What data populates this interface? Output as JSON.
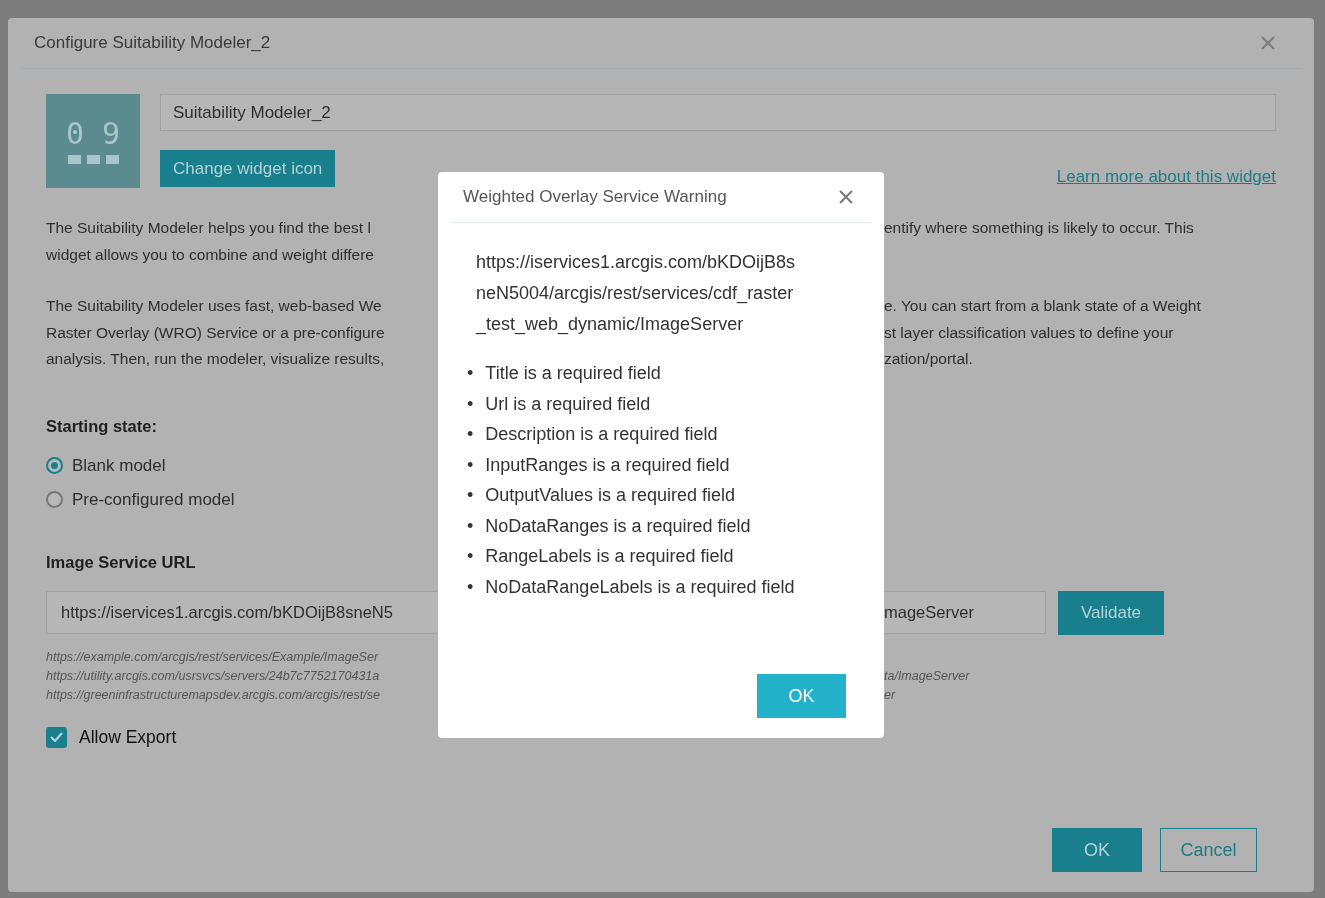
{
  "config_dialog": {
    "title": "Configure Suitability Modeler_2",
    "widget_icon_label": "0 9",
    "name_field": {
      "value": "Suitability Modeler_2"
    },
    "change_icon_button": "Change widget icon",
    "learn_more_link": "Learn more about this widget",
    "description": [
      [
        {
          "left": "The Suitability Modeler helps you find the best l",
          "right": "entify where something is likely to occur. This"
        },
        {
          "left": "widget allows you to combine and weight differe"
        }
      ],
      [
        {
          "left": "The Suitability Modeler uses fast, web-based We",
          "right": "e. You can start from a blank state of a Weight"
        },
        {
          "left": "Raster Overlay (WRO) Service or a pre-configure",
          "right": "st layer classification values to define your"
        },
        {
          "left": "analysis. Then, run the modeler, visualize results,",
          "right": "zation/portal."
        }
      ]
    ],
    "starting_state": {
      "label": "Starting state:",
      "options": [
        {
          "label": "Blank model",
          "selected": true
        },
        {
          "label": "Pre-configured model",
          "selected": false
        }
      ]
    },
    "image_service_url": {
      "label": "Image Service URL",
      "value_left": "https://iservices1.arcgis.com/bKDOijB8sneN5",
      "value_right": "mageServer"
    },
    "validate_button": "Validate",
    "examples": [
      {
        "left": "https://example.com/arcgis/rest/services/Example/ImageSer"
      },
      {
        "left": "https://utility.arcgis.com/usrsvcs/servers/24b7c7752170431a",
        "right": "ta/ImageServer"
      },
      {
        "left": "https://greeninfrastructuremapsdev.arcgis.com/arcgis/rest/se",
        "right": "er"
      }
    ],
    "allow_export": {
      "label": "Allow Export",
      "checked": true
    },
    "buttons": [
      {
        "label": "OK",
        "kind": "primary"
      },
      {
        "label": "Cancel",
        "kind": "secondary"
      }
    ]
  },
  "warning_dialog": {
    "title": "Weighted Overlay Service Warning",
    "message": "https://iservices1.arcgis.com/bKDOijB8sneN5004/arcgis/rest/services/cdf_raster_test_web_dynamic/ImageServer",
    "items": [
      {
        "bullet": "•",
        "text": "Title is a required field"
      },
      {
        "bullet": "•",
        "text": "Url is a required field"
      },
      {
        "bullet": "•",
        "text": "Description is a required field"
      },
      {
        "bullet": "•",
        "text": "InputRanges is a required field"
      },
      {
        "bullet": "•",
        "text": "OutputValues is a required field"
      },
      {
        "bullet": "•",
        "text": "NoDataRanges is a required field"
      },
      {
        "bullet": "•",
        "text": "RangeLabels is a required field"
      },
      {
        "bullet": "•",
        "text": "NoDataRangeLabels is a required field"
      }
    ],
    "button": "OK"
  }
}
